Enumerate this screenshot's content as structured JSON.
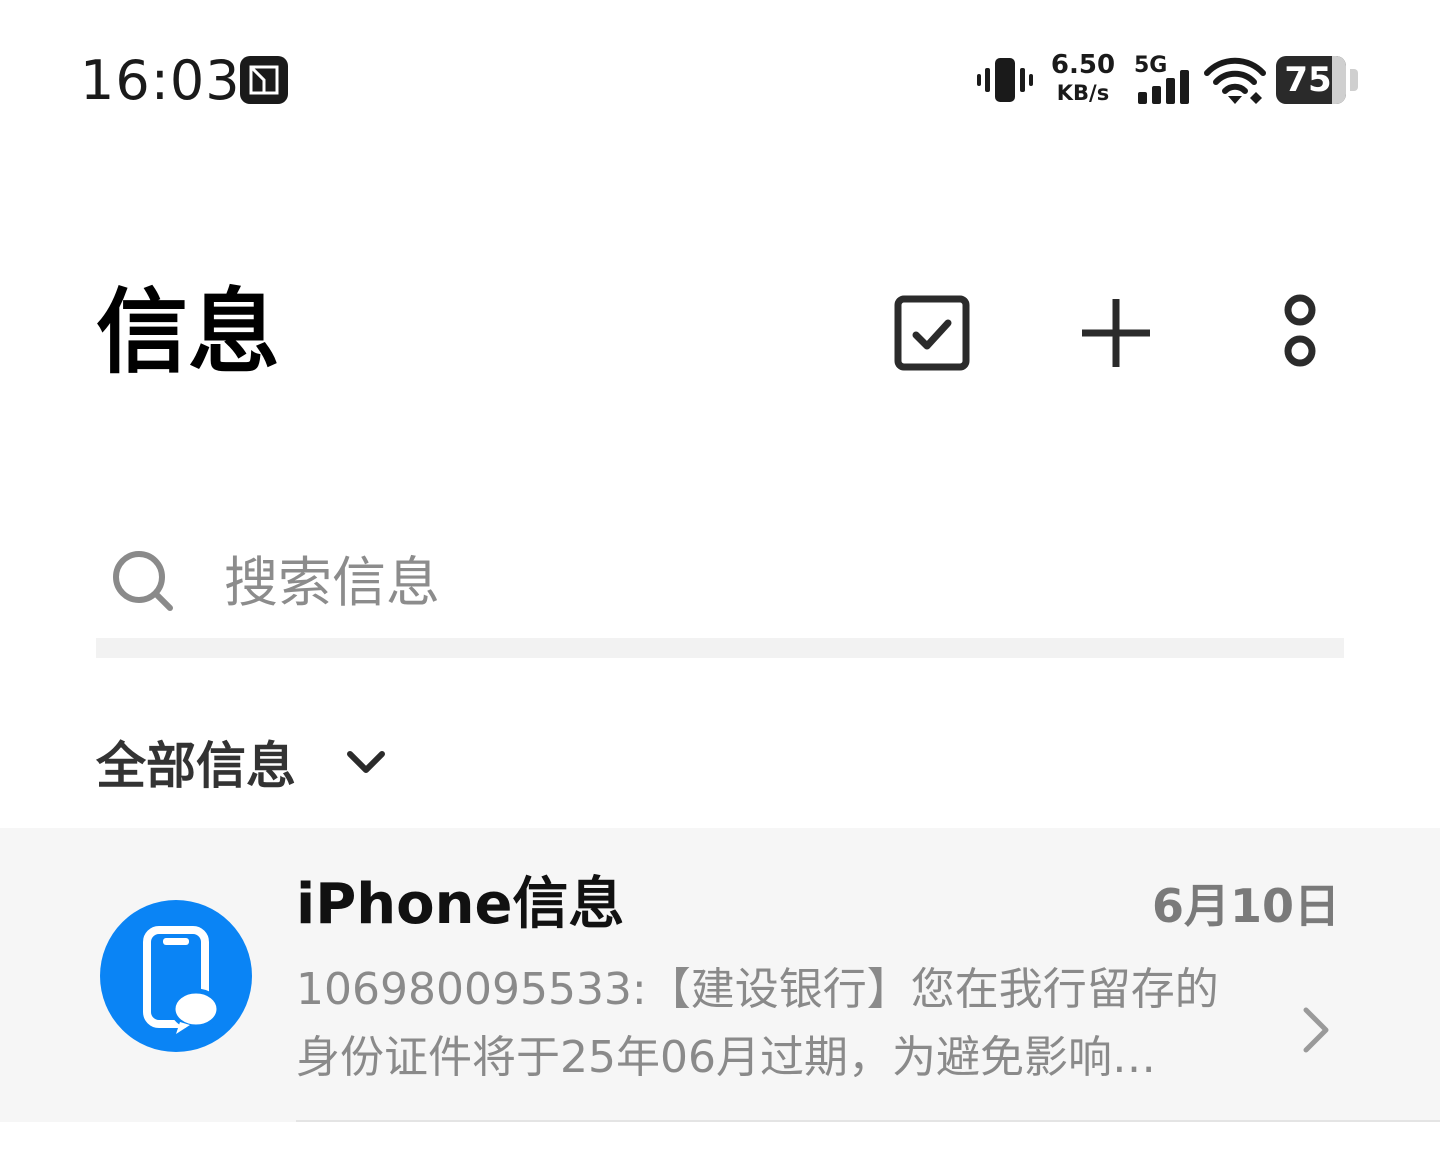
{
  "status_bar": {
    "time": "16:03",
    "app_icon": "gallery-app-icon",
    "net_speed_value": "6.50",
    "net_speed_unit": "KB/s",
    "network_type": "5G",
    "battery_level": "75",
    "icons": [
      "vibrate-icon",
      "signal-icon",
      "wifi-icon",
      "battery-icon"
    ]
  },
  "header": {
    "title": "信息",
    "actions": [
      "select-checkbox-icon",
      "plus-icon",
      "more-icon"
    ]
  },
  "search": {
    "placeholder": "搜索信息",
    "icon": "search-icon"
  },
  "filter": {
    "label": "全部信息",
    "icon": "chevron-down-icon"
  },
  "conversations": [
    {
      "title": "iPhone信息",
      "date": "6月10日",
      "preview": "106980095533:【建设银行】您在我行留存的身份证件将于25年06月过期，为避免影响…",
      "avatar_icon": "iphone-message-icon",
      "avatar_color": "#0A84F5"
    }
  ],
  "colors": {
    "accent": "#0A84F5",
    "row_background": "#F6F6F6"
  }
}
